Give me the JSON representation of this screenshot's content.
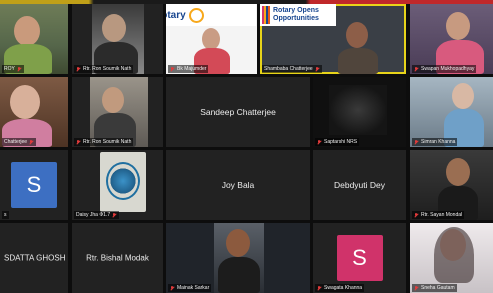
{
  "colors": {
    "active_border": "#e8d41a",
    "mic_muted": "#e23b3b",
    "avatar_s_blue": "#3d6fc2",
    "avatar_s_pink": "#d0336a"
  },
  "banner": {
    "rotary": "Rotary",
    "slogan_line1": "Rotary Opens",
    "slogan_line2": "Opportunities"
  },
  "participants": [
    {
      "name": "ROY",
      "muted": true
    },
    {
      "name": "Rtr. Ron Soumik Nath",
      "muted": true
    },
    {
      "name": "Bk Majumder",
      "muted": true
    },
    {
      "name": "Shambaba Chatterjee",
      "muted": true
    },
    {
      "name": "Swapan Mukhopadhyay",
      "muted": true
    },
    {
      "name": "Chatterjee",
      "muted": true
    },
    {
      "name": "Rtr. Ron Soumik Nath",
      "muted": true
    },
    {
      "name": "Sandeep Chatterjee",
      "muted": false
    },
    {
      "name": "Saptarshi NRS",
      "muted": true
    },
    {
      "name": "Simran Khanna",
      "muted": true
    },
    {
      "name": "s",
      "muted": false
    },
    {
      "name": "Daisy Jha Ф1.7",
      "muted": true
    },
    {
      "name": "Joy Bala",
      "muted": false
    },
    {
      "name": "Debdyuti Dey",
      "muted": false
    },
    {
      "name": "Rtr. Sayan Mondal",
      "muted": true
    },
    {
      "name": "SDATTA GHOSH",
      "muted": false
    },
    {
      "name": "Rtr. Bishal Modak",
      "muted": false
    },
    {
      "name": "Mainak Sarkar",
      "muted": true
    },
    {
      "name": "Swagata Khanna",
      "muted": true
    },
    {
      "name": "Sneha Gautam",
      "muted": true
    }
  ],
  "avatars": {
    "s_blue": "S",
    "s_pink": "S"
  }
}
